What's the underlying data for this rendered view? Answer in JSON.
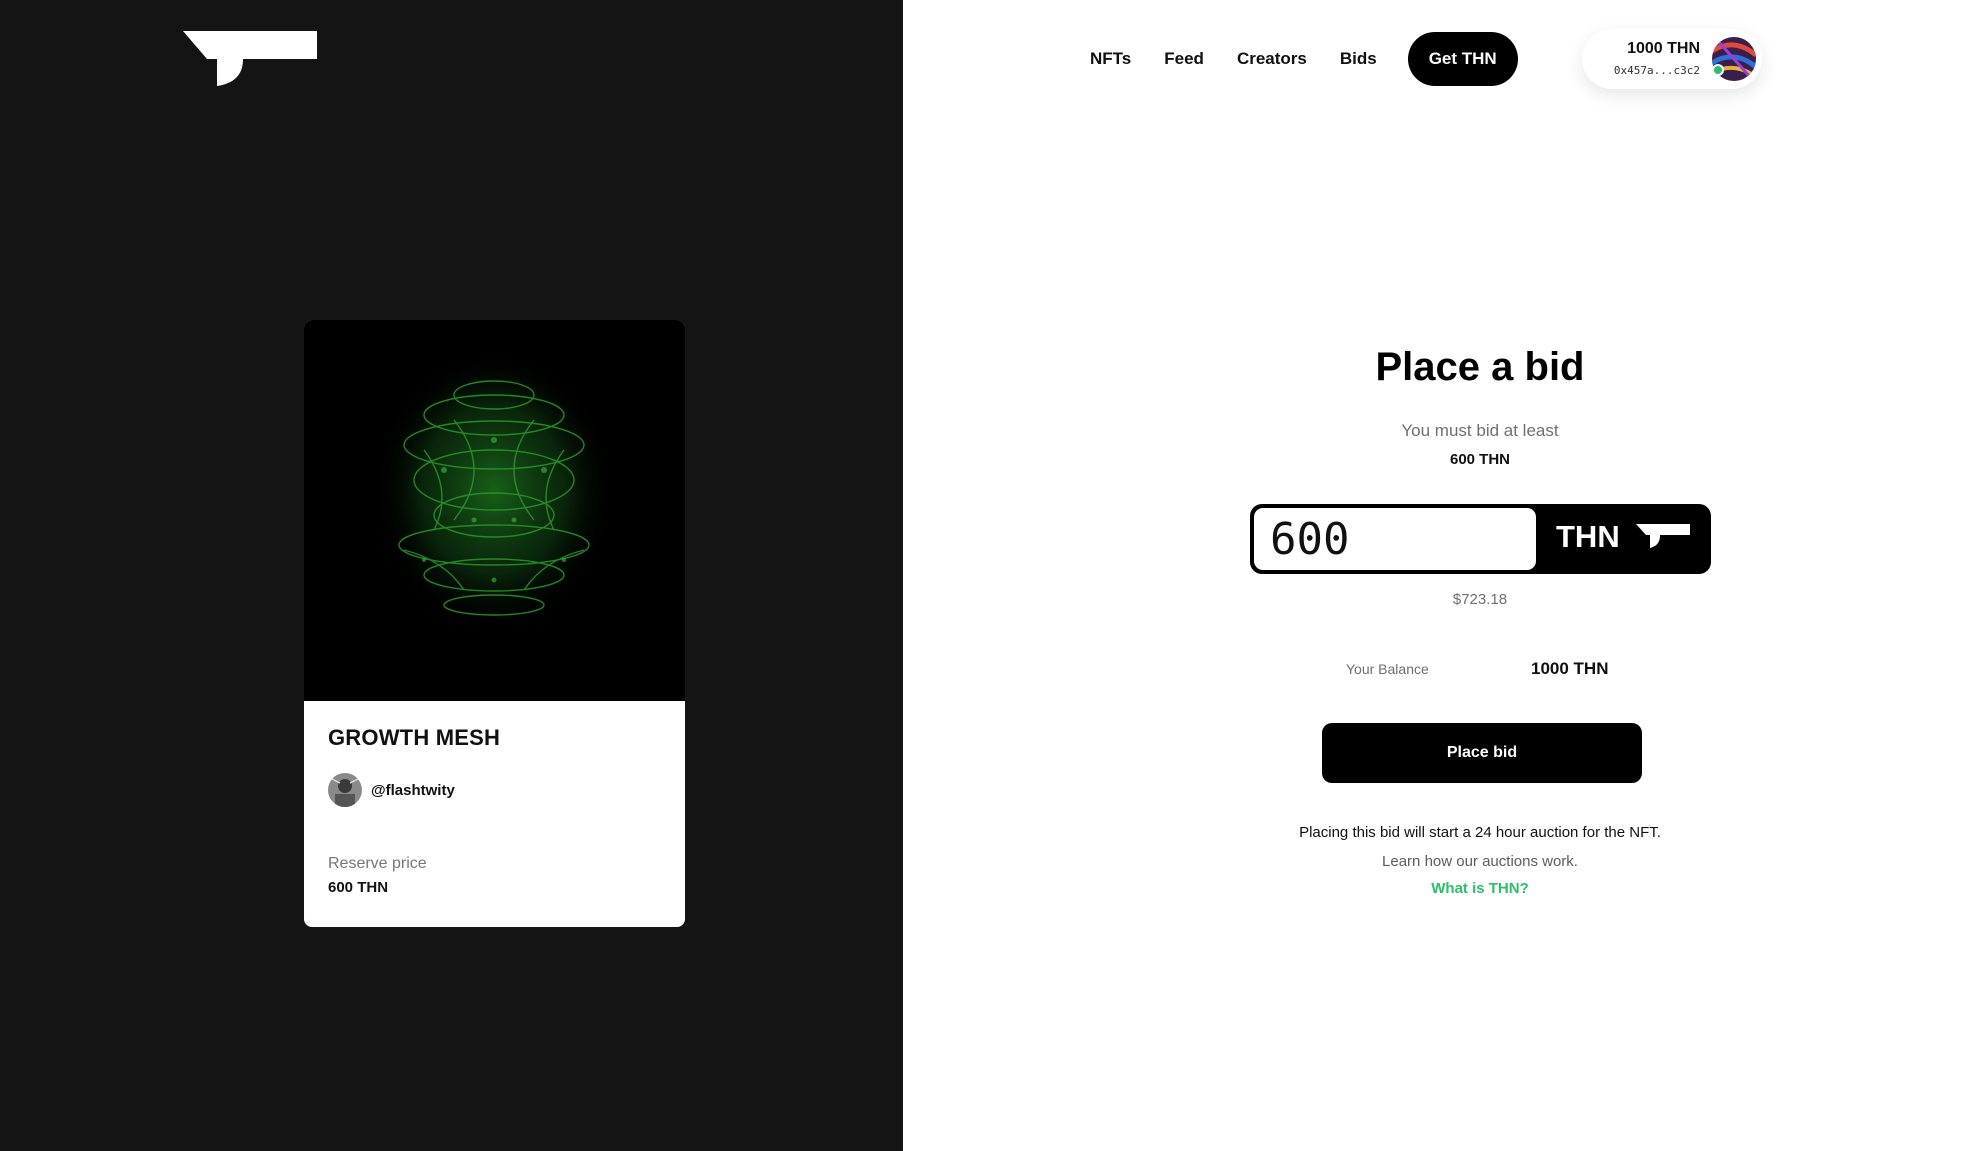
{
  "brand": {
    "logo_icon": "thn-logo-icon"
  },
  "nav": {
    "links": [
      "NFTs",
      "Feed",
      "Creators",
      "Bids"
    ],
    "cta_label": "Get THN"
  },
  "wallet": {
    "balance": "1000 THN",
    "address": "0x457a...c3c2",
    "online_color": "#2bbf6a"
  },
  "nft": {
    "title": "GROWTH MESH",
    "creator_handle": "@flashtwity",
    "reserve_label": "Reserve price",
    "reserve_value": "600 THN"
  },
  "bid": {
    "title": "Place a bid",
    "min_label": "You must bid at least",
    "min_value": "600 THN",
    "amount": "600",
    "currency": "THN",
    "usd_value": "$723.18",
    "balance_label": "Your Balance",
    "balance_value": "1000 THN",
    "submit_label": "Place bid",
    "info_text": "Placing this bid will start a 24 hour auction for the NFT.",
    "learn_link": "Learn how our auctions work.",
    "what_link": "What is THN?"
  },
  "colors": {
    "left_bg": "#141414",
    "accent_green": "#2bbf6a",
    "button_bg": "#000000"
  }
}
